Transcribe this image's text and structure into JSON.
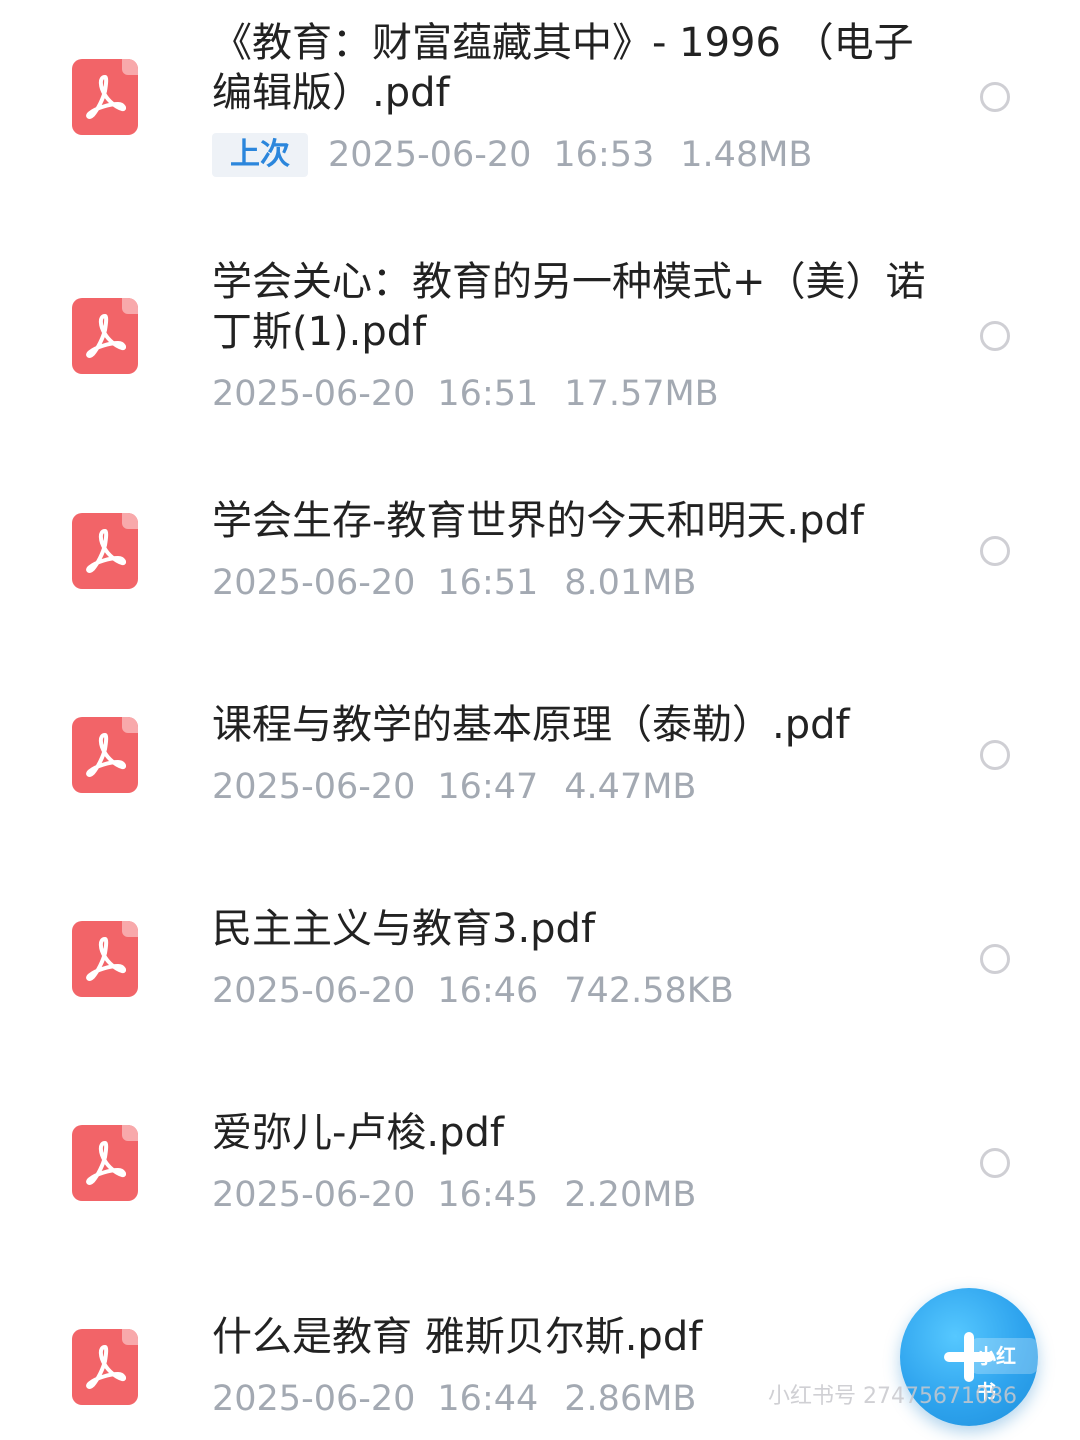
{
  "badge": {
    "recent": "上次"
  },
  "files": [
    {
      "name": "《教育：财富蕴藏其中》- 1996 （电子编辑版）.pdf",
      "date": "2025-06-20",
      "time": "16:53",
      "size": "1.48MB",
      "recent": true
    },
    {
      "name": "学会关心：教育的另一种模式+（美）诺丁斯(1).pdf",
      "date": "2025-06-20",
      "time": "16:51",
      "size": "17.57MB",
      "recent": false
    },
    {
      "name": "学会生存-教育世界的今天和明天.pdf",
      "date": "2025-06-20",
      "time": "16:51",
      "size": "8.01MB",
      "recent": false
    },
    {
      "name": "课程与教学的基本原理（泰勒）.pdf",
      "date": "2025-06-20",
      "time": "16:47",
      "size": "4.47MB",
      "recent": false
    },
    {
      "name": "民主主义与教育3.pdf",
      "date": "2025-06-20",
      "time": "16:46",
      "size": "742.58KB",
      "recent": false
    },
    {
      "name": "爱弥儿-卢梭.pdf",
      "date": "2025-06-20",
      "time": "16:45",
      "size": "2.20MB",
      "recent": false
    },
    {
      "name": "什么是教育 雅斯贝尔斯.pdf",
      "date": "2025-06-20",
      "time": "16:44",
      "size": "2.86MB",
      "recent": false
    }
  ],
  "fab": {
    "tag": "小红书",
    "icon": "plus-icon"
  },
  "watermark": "小红书号 27475671086",
  "colors": {
    "pdf_icon": "#f26468",
    "badge_text": "#2b86dc",
    "meta_text": "#a3a9b2",
    "fab": "#2fa4ee"
  }
}
